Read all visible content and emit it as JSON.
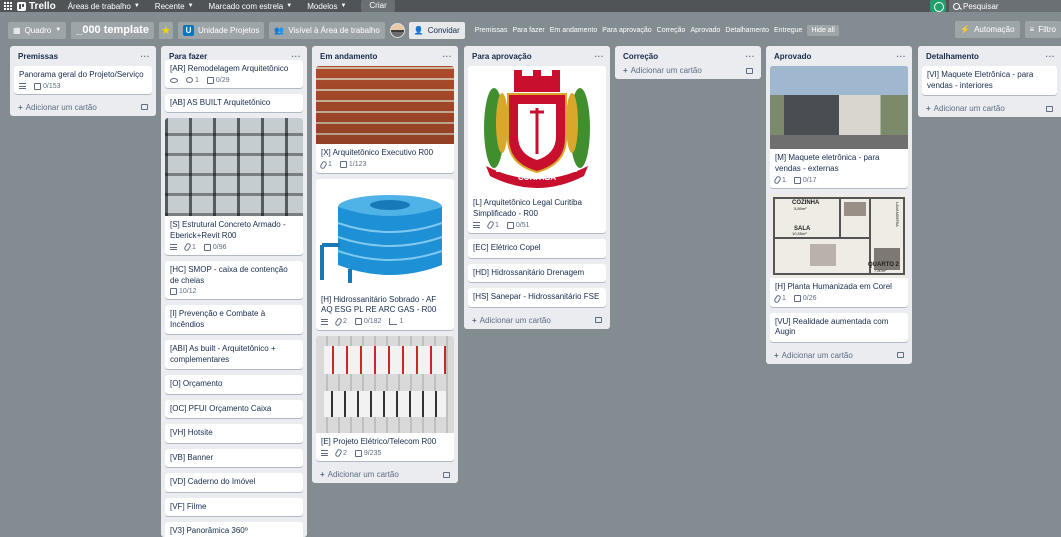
{
  "topbar": {
    "logo": "Trello",
    "nav": [
      "Áreas de trabalho",
      "Recente",
      "Marcado com estrela",
      "Modelos"
    ],
    "create": "Criar",
    "search_placeholder": "Pesquisar"
  },
  "board_header": {
    "view": "Quadro",
    "title": "_000 template",
    "workspace": "Unidade Projetos",
    "visibility": "Visível à Área de trabalho",
    "invite": "Convidar",
    "quick_filters": [
      "Premissas",
      "Para fazer",
      "Em andamento",
      "Para aprovação",
      "Correção",
      "Aprovado",
      "Detalhamento",
      "Entregue"
    ],
    "hide_all": "Hide all",
    "automation": "Automação",
    "filter": "Filtro"
  },
  "add_card_label": "Adicionar um cartão",
  "lists": [
    {
      "name": "Premissas",
      "cards": [
        {
          "title": "Panorama geral do Projeto/Serviço",
          "desc": true,
          "checklist": "0/153"
        }
      ]
    },
    {
      "name": "Para fazer",
      "cards": [
        {
          "title": "[AR] Remodelagem Arquitetônico",
          "watch": true,
          "comments": "1",
          "checklist": "0/29"
        },
        {
          "title": "[AB] AS BUILT Arquitetônico"
        },
        {
          "title": "[S] Estrutural Concreto Armado - Eberick+Revit R00",
          "cover": "building",
          "desc": true,
          "attachments": "1",
          "checklist": "0/96"
        },
        {
          "title": "[HC] SMOP - caixa de contenção de cheias",
          "checklist": "10/12"
        },
        {
          "title": "[I] Prevenção e Combate à Incêndios"
        },
        {
          "title": "[ABI] As built - Arquitetônico + complementares"
        },
        {
          "title": "[O] Orçamento"
        },
        {
          "title": "[OC] PFUI Orçamento Caixa"
        },
        {
          "title": "[VH] Hotsite"
        },
        {
          "title": "[VB] Banner"
        },
        {
          "title": "[VD] Caderno do Imóvel"
        },
        {
          "title": "[VF] Filme"
        },
        {
          "title": "[V3] Panorâmica 360º"
        }
      ]
    },
    {
      "name": "Em andamento",
      "cards": [
        {
          "title": "[X] Arquitetônico Executivo R00",
          "cover": "bricks",
          "attachments": "1",
          "checklist": "1/123"
        },
        {
          "title": "[H] Hidrossanitário Sobrado - AF AQ ESG PL RE ARC GAS - R00",
          "cover": "tank",
          "desc": true,
          "attachments": "2",
          "checklist": "0/182",
          "subtasks": "1"
        },
        {
          "title": "[E] Projeto Elétrico/Telecom R00",
          "cover": "panel",
          "desc": true,
          "attachments": "2",
          "checklist": "9/235"
        }
      ]
    },
    {
      "name": "Para aprovação",
      "cards": [
        {
          "title": "[L] Arquitetônico Legal Curitiba Simplificado - R00",
          "cover": "coat",
          "cover_text": "CURITIBA",
          "cover_left": "29.3",
          "cover_right": "1693",
          "desc": true,
          "attachments": "1",
          "checklist": "0/51"
        },
        {
          "title": "[EC] Elétrico Copel"
        },
        {
          "title": "[HD] Hidrossanitário Drenagem"
        },
        {
          "title": "[HS] Sanepar - Hidrossanitário FSE"
        }
      ]
    },
    {
      "name": "Correção",
      "cards": []
    },
    {
      "name": "Aprovado",
      "cards": [
        {
          "title": "[M] Maquete eletrônica - para vendas - externas",
          "cover": "house",
          "attachments": "1",
          "checklist": "0/17"
        },
        {
          "title": "[H] Planta Humanizada em Corel",
          "cover": "plan",
          "plan_labels": [
            "COZINHA",
            "SALA",
            "QUARTO 2",
            "LAVANDERIA"
          ],
          "plan_areas": [
            "5,89m²",
            "10,55m²",
            "7,80m²"
          ],
          "attachments": "1",
          "checklist": "0/26"
        },
        {
          "title": "[VU] Realidade aumentada com Augin"
        }
      ]
    },
    {
      "name": "Detalhamento",
      "cards": [
        {
          "title": "[VI] Maquete Eletrônica - para vendas - interiores"
        }
      ]
    }
  ]
}
